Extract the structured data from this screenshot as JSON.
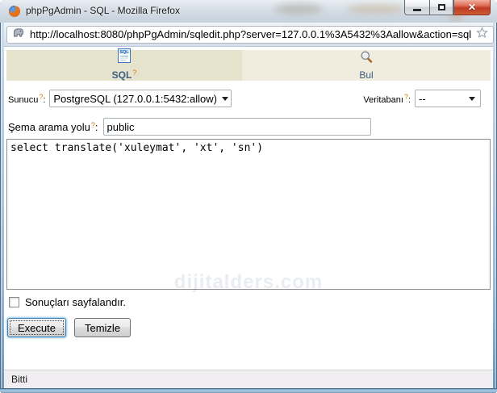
{
  "window": {
    "title": "phpPgAdmin - SQL - Mozilla Firefox",
    "status": "Bitti"
  },
  "toolbar": {
    "url": "http://localhost:8080/phpPgAdmin/sqledit.php?server=127.0.0.1%3A5432%3Aallow&action=sql"
  },
  "tabs": [
    {
      "label": "SQL",
      "active": true
    },
    {
      "label": "Bul",
      "active": false
    }
  ],
  "form": {
    "help_mark": "?",
    "colon": ":",
    "server": {
      "label": "Sunucu",
      "value": "PostgreSQL (127.0.0.1:5432:allow)"
    },
    "database": {
      "label": "Veritabanı",
      "value": "--"
    },
    "schema": {
      "label": "Şema arama yolu",
      "value": "public"
    },
    "sql_query": "select translate('xuleymat', 'xt', 'sn')",
    "paginate": {
      "label": "Sonuçları sayfalandır.",
      "checked": false
    },
    "buttons": {
      "execute": "Execute",
      "clear": "Temizle"
    }
  },
  "watermark": "dijitalders.com",
  "icons": {
    "firefox_icon": "firefox-logo",
    "site_icon": "postgresql-elephant",
    "bookmark_icon": "star-outline",
    "sql_tab_icon_text": "SQL",
    "search_icon": "magnifier"
  },
  "colors": {
    "tab_active_bg": "#e6e3cd",
    "tab_inactive_bg": "#f0edde",
    "help_orange": "#d07d00",
    "tab_label_blue": "#3a5d80",
    "close_button_red": "#c03a22",
    "focus_border_blue": "#3c7fb1"
  }
}
